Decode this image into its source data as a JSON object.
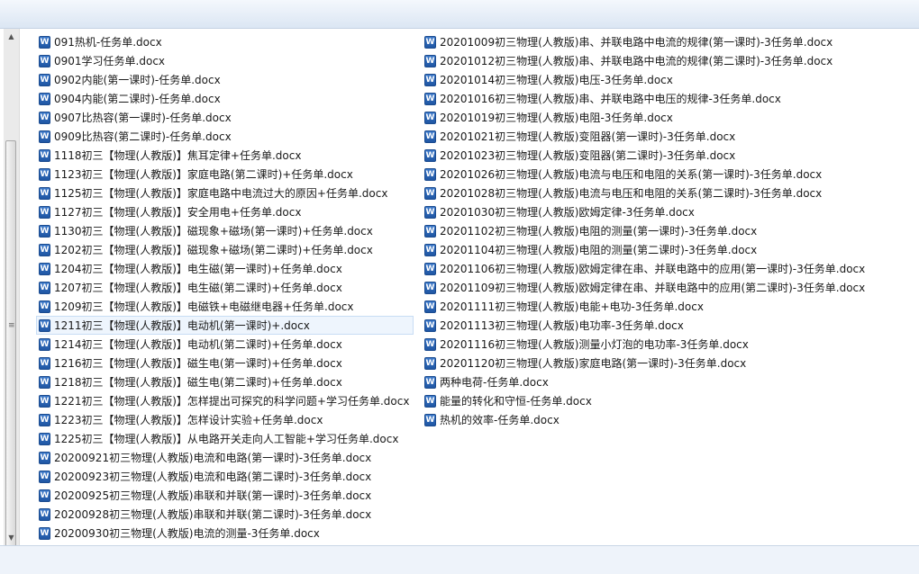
{
  "file_icon": "word-document-icon",
  "icon_letter": "W",
  "scroll_grip": "≡",
  "files_col1": [
    {
      "name": "091热机-任务单.docx"
    },
    {
      "name": "0901学习任务单.docx"
    },
    {
      "name": "0902内能(第一课时)-任务单.docx"
    },
    {
      "name": "0904内能(第二课时)-任务单.docx"
    },
    {
      "name": "0907比热容(第一课时)-任务单.docx"
    },
    {
      "name": "0909比热容(第二课时)-任务单.docx"
    },
    {
      "name": "1118初三【物理(人教版)】焦耳定律+任务单.docx"
    },
    {
      "name": "1123初三【物理(人教版)】家庭电路(第二课时)+任务单.docx"
    },
    {
      "name": "1125初三【物理(人教版)】家庭电路中电流过大的原因+任务单.docx"
    },
    {
      "name": "1127初三【物理(人教版)】安全用电+任务单.docx"
    },
    {
      "name": "1130初三【物理(人教版)】磁现象+磁场(第一课时)+任务单.docx"
    },
    {
      "name": "1202初三【物理(人教版)】磁现象+磁场(第二课时)+任务单.docx"
    },
    {
      "name": "1204初三【物理(人教版)】电生磁(第一课时)+任务单.docx"
    },
    {
      "name": "1207初三【物理(人教版)】电生磁(第二课时)+任务单.docx"
    },
    {
      "name": "1209初三【物理(人教版)】电磁铁+电磁继电器+任务单.docx"
    },
    {
      "name": "1211初三【物理(人教版)】电动机(第一课时)+.docx",
      "selected": true
    },
    {
      "name": "1214初三【物理(人教版)】电动机(第二课时)+任务单.docx"
    },
    {
      "name": "1216初三【物理(人教版)】磁生电(第一课时)+任务单.docx"
    },
    {
      "name": "1218初三【物理(人教版)】磁生电(第二课时)+任务单.docx"
    },
    {
      "name": "1221初三【物理(人教版)】怎样提出可探究的科学问题+学习任务单.docx"
    },
    {
      "name": "1223初三【物理(人教版)】怎样设计实验+任务单.docx"
    },
    {
      "name": "1225初三【物理(人教版)】从电路开关走向人工智能+学习任务单.docx"
    },
    {
      "name": "20200921初三物理(人教版)电流和电路(第一课时)-3任务单.docx"
    },
    {
      "name": "20200923初三物理(人教版)电流和电路(第二课时)-3任务单.docx"
    },
    {
      "name": "20200925初三物理(人教版)串联和并联(第一课时)-3任务单.docx"
    },
    {
      "name": "20200928初三物理(人教版)串联和并联(第二课时)-3任务单.docx"
    },
    {
      "name": "20200930初三物理(人教版)电流的测量-3任务单.docx"
    }
  ],
  "files_col2": [
    {
      "name": "20201009初三物理(人教版)串、并联电路中电流的规律(第一课时)-3任务单.docx"
    },
    {
      "name": "20201012初三物理(人教版)串、并联电路中电流的规律(第二课时)-3任务单.docx"
    },
    {
      "name": "20201014初三物理(人教版)电压-3任务单.docx"
    },
    {
      "name": "20201016初三物理(人教版)串、并联电路中电压的规律-3任务单.docx"
    },
    {
      "name": "20201019初三物理(人教版)电阻-3任务单.docx"
    },
    {
      "name": "20201021初三物理(人教版)变阻器(第一课时)-3任务单.docx"
    },
    {
      "name": "20201023初三物理(人教版)变阻器(第二课时)-3任务单.docx"
    },
    {
      "name": "20201026初三物理(人教版)电流与电压和电阻的关系(第一课时)-3任务单.docx"
    },
    {
      "name": "20201028初三物理(人教版)电流与电压和电阻的关系(第二课时)-3任务单.docx"
    },
    {
      "name": "20201030初三物理(人教版)欧姆定律-3任务单.docx"
    },
    {
      "name": "20201102初三物理(人教版)电阻的测量(第一课时)-3任务单.docx"
    },
    {
      "name": "20201104初三物理(人教版)电阻的测量(第二课时)-3任务单.docx"
    },
    {
      "name": "20201106初三物理(人教版)欧姆定律在串、并联电路中的应用(第一课时)-3任务单.docx"
    },
    {
      "name": "20201109初三物理(人教版)欧姆定律在串、并联电路中的应用(第二课时)-3任务单.docx"
    },
    {
      "name": "20201111初三物理(人教版)电能+电功-3任务单.docx"
    },
    {
      "name": "20201113初三物理(人教版)电功率-3任务单.docx"
    },
    {
      "name": "20201116初三物理(人教版)测量小灯泡的电功率-3任务单.docx"
    },
    {
      "name": "20201120初三物理(人教版)家庭电路(第一课时)-3任务单.docx"
    },
    {
      "name": "两种电荷-任务单.docx"
    },
    {
      "name": "能量的转化和守恒-任务单.docx"
    },
    {
      "name": "热机的效率-任务单.docx"
    }
  ]
}
